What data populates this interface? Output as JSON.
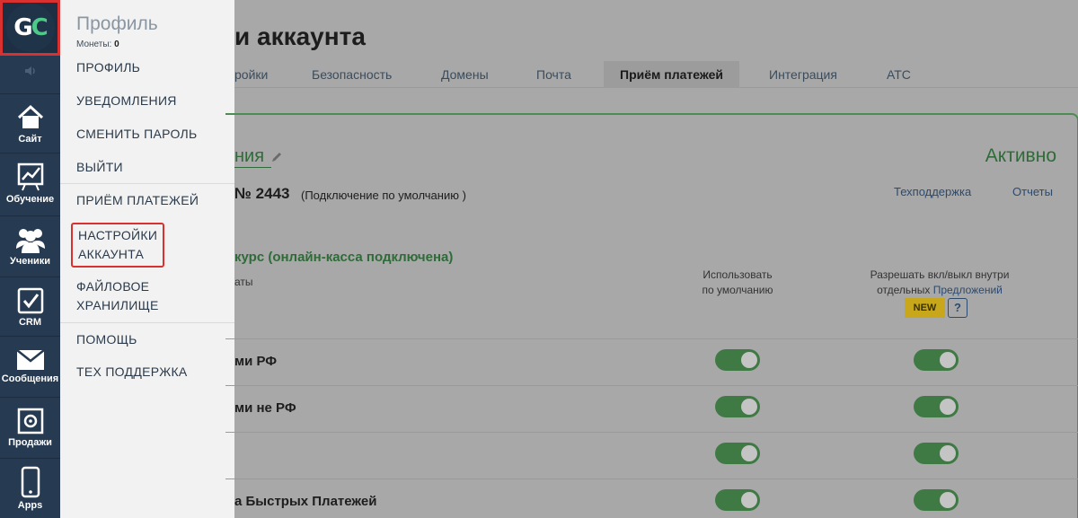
{
  "logo": {
    "text_g": "G",
    "text_c": "C"
  },
  "sidebar": {
    "items": [
      {
        "label": "Сайт",
        "icon": "home-icon"
      },
      {
        "label": "Обучение",
        "icon": "chart-icon"
      },
      {
        "label": "Ученики",
        "icon": "users-icon"
      },
      {
        "label": "CRM",
        "icon": "checkbox-icon"
      },
      {
        "label": "Сообщения",
        "icon": "envelope-icon"
      },
      {
        "label": "Продажи",
        "icon": "safe-icon"
      },
      {
        "label": "Apps",
        "icon": "phone-icon"
      }
    ]
  },
  "menu": {
    "title": "Профиль",
    "coins_label": "Монеты:",
    "coins_value": "0",
    "items": [
      {
        "label": "ПРОФИЛЬ"
      },
      {
        "label": "УВЕДОМЛЕНИЯ"
      },
      {
        "label": "СМЕНИТЬ ПАРОЛЬ"
      },
      {
        "label": "ВЫЙТИ"
      },
      {
        "label": "ПРИЁМ ПЛАТЕЖЕЙ"
      },
      {
        "label_line1": "НАСТРОЙКИ",
        "label_line2": "АККАУНТА"
      },
      {
        "label_line1": "ФАЙЛОВОЕ",
        "label_line2": "ХРАНИЛИЩЕ"
      },
      {
        "label": "ПОМОЩЬ"
      },
      {
        "label": "ТЕХ ПОДДЕРЖКА"
      }
    ]
  },
  "page": {
    "title": "и аккаунта",
    "tabs": [
      {
        "label": "ройки"
      },
      {
        "label": "Безопасность"
      },
      {
        "label": "Домены"
      },
      {
        "label": "Почта"
      },
      {
        "label": "Приём платежей",
        "active": true
      },
      {
        "label": "Интеграция"
      },
      {
        "label": "АТС"
      }
    ],
    "connection": {
      "name": "ния",
      "status": "Активно",
      "number": "№ 2443",
      "note": "(Подключение по умолчанию )",
      "support_link": "Техподдержка",
      "reports_link": "Отчеты",
      "provider": "курс (онлайн-касса подключена)",
      "methods_header": "аты",
      "default_header_line1": "Использовать",
      "default_header_line2": "по умолчанию",
      "allow_header_line1": "Разрешать вкл/выкл внутри",
      "allow_header_line2_prefix": "отдельных ",
      "allow_header_link": "Предложений",
      "new_badge": "NEW",
      "help_badge": "?"
    },
    "rows": [
      {
        "label": "ми РФ",
        "use_default": true,
        "allow_toggle": true
      },
      {
        "label": "ми не РФ",
        "use_default": true,
        "allow_toggle": true
      },
      {
        "label": "",
        "use_default": true,
        "allow_toggle": true
      },
      {
        "label": "а Быстрых Платежей",
        "use_default": true,
        "allow_toggle": true
      }
    ]
  },
  "colors": {
    "sidebar_bg": "#263a52",
    "accent_green": "#2f6b38",
    "highlight_red": "#d9312f",
    "toggle_on": "#3f7a45"
  }
}
